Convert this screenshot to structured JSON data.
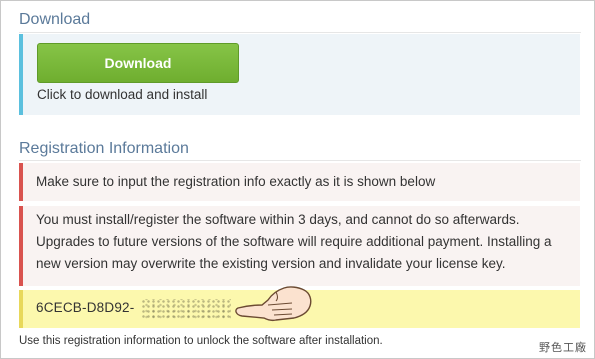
{
  "download": {
    "section_title": "Download",
    "button_label": "Download",
    "caption": "Click to download and install"
  },
  "registration": {
    "section_title": "Registration Information",
    "notice_1": "Make sure to input the registration info exactly as it is shown below",
    "notice_2_line1": "You must install/register the software within 3 days, and cannot do so afterwards.",
    "notice_2_line2": "Upgrades to future versions of the software will require additional payment. Installing a",
    "notice_2_line3": "new version may overwrite the existing version and invalidate your license key.",
    "key_visible": "6CECB-D8D92-",
    "footnote": "Use this registration information to unlock the software after installation."
  },
  "watermark": "野色工廠",
  "colors": {
    "download_accent": "#5bc0de",
    "button_green": "#78b83a",
    "alert_red": "#d9534f",
    "key_highlight": "#fcf8ad",
    "title_blue": "#5b7a9a"
  },
  "icons": [
    "pointing-hand-icon"
  ]
}
